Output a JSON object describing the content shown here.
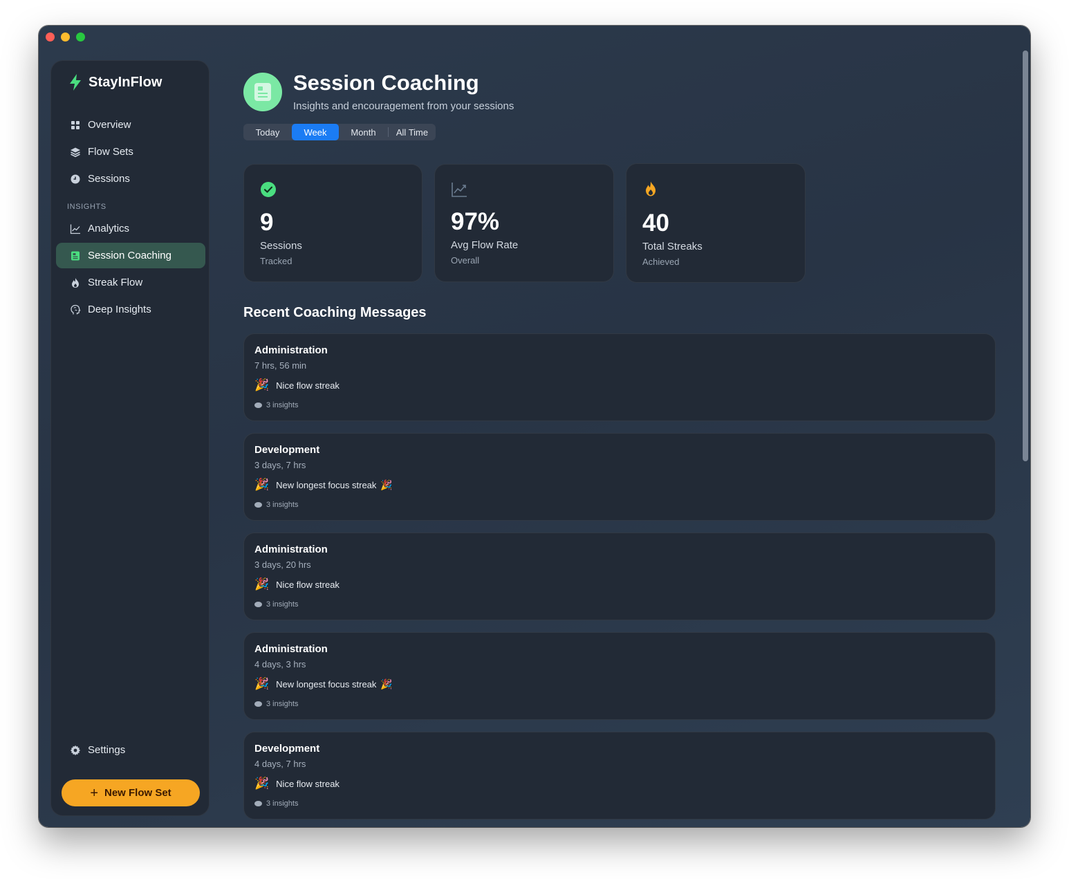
{
  "app": {
    "name": "StayInFlow"
  },
  "sidebar": {
    "items": [
      {
        "label": "Overview",
        "icon": "grid-icon"
      },
      {
        "label": "Flow Sets",
        "icon": "layers-icon"
      },
      {
        "label": "Sessions",
        "icon": "clock-icon"
      }
    ],
    "section_label": "INSIGHTS",
    "insight_items": [
      {
        "label": "Analytics",
        "icon": "chart-line-icon"
      },
      {
        "label": "Session Coaching",
        "icon": "coaching-icon",
        "active": true
      },
      {
        "label": "Streak Flow",
        "icon": "flame-icon"
      },
      {
        "label": "Deep Insights",
        "icon": "brain-icon"
      }
    ],
    "settings_label": "Settings",
    "new_flow_label": "New Flow Set"
  },
  "header": {
    "title": "Session Coaching",
    "subtitle": "Insights and encouragement from your sessions"
  },
  "periods": {
    "options": [
      "Today",
      "Week",
      "Month",
      "All Time"
    ],
    "selected": "Week"
  },
  "stats": [
    {
      "value": "9",
      "label": "Sessions",
      "sub": "Tracked",
      "icon": "check-circle-icon",
      "color": "#4ade80"
    },
    {
      "value": "97%",
      "label": "Avg Flow Rate",
      "sub": "Overall",
      "icon": "chart-line-icon",
      "color": "#6b7c90"
    },
    {
      "value": "40",
      "label": "Total Streaks",
      "sub": "Achieved",
      "icon": "flame-icon",
      "color": "#f6a623"
    }
  ],
  "recent_title": "Recent Coaching Messages",
  "messages": [
    {
      "title": "Administration",
      "duration": "7 hrs, 56 min",
      "message": "Nice flow streak",
      "trailing_emoji": false,
      "insights": "3 insights"
    },
    {
      "title": "Development",
      "duration": "3 days, 7 hrs",
      "message": "New longest focus streak",
      "trailing_emoji": true,
      "insights": "3 insights"
    },
    {
      "title": "Administration",
      "duration": "3 days, 20 hrs",
      "message": "Nice flow streak",
      "trailing_emoji": false,
      "insights": "3 insights"
    },
    {
      "title": "Administration",
      "duration": "4 days, 3 hrs",
      "message": "New longest focus streak",
      "trailing_emoji": true,
      "insights": "3 insights"
    },
    {
      "title": "Development",
      "duration": "4 days, 7 hrs",
      "message": "Nice flow streak",
      "trailing_emoji": false,
      "insights": "3 insights"
    }
  ],
  "emoji": "🎉",
  "colors": {
    "accent": "#1b7cf4",
    "brand": "#4ade80",
    "cta": "#f6a623",
    "active_nav": "#35584f"
  }
}
